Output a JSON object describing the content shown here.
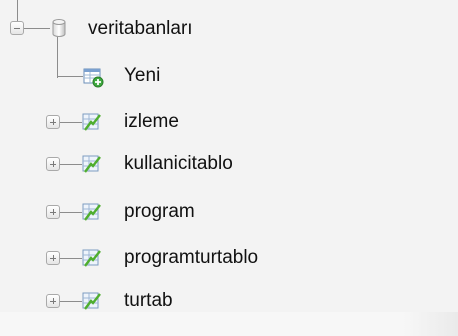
{
  "tree": {
    "root": {
      "label": "veritabanları",
      "icon": "database-icon",
      "expander": "minus"
    },
    "children": [
      {
        "label": "Yeni",
        "icon": "new-table-icon",
        "expander": "none"
      },
      {
        "label": "izleme",
        "icon": "table-structure-icon",
        "expander": "plus"
      },
      {
        "label": "kullanicitablo",
        "icon": "table-structure-icon",
        "expander": "plus"
      },
      {
        "label": "program",
        "icon": "table-structure-icon",
        "expander": "plus"
      },
      {
        "label": "programturtablo",
        "icon": "table-structure-icon",
        "expander": "plus"
      },
      {
        "label": "turtab",
        "icon": "table-structure-icon",
        "expander": "plus"
      }
    ]
  }
}
